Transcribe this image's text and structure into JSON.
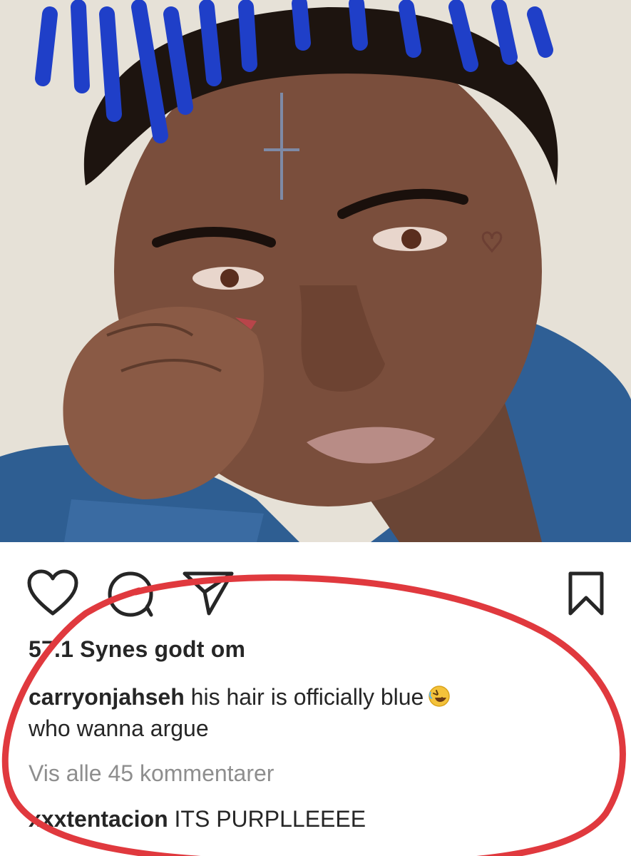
{
  "post": {
    "image_alt": "portrait photo of a man with blue dreadlocks, resting his face on his hand",
    "accent_hair_color": "#1f3fc8",
    "jacket_color": "#2f5f95"
  },
  "actions": {
    "like_icon": "heart-icon",
    "comment_icon": "comment-bubble-icon",
    "share_icon": "paper-plane-icon",
    "save_icon": "bookmark-icon"
  },
  "likes": {
    "text": "57.1 Synes godt om"
  },
  "caption": {
    "username": "carryonjahseh",
    "text_line1": " his hair is officially blue",
    "emoji": "rolling-on-floor-laughing-emoji",
    "text_line2": "who wanna argue"
  },
  "comments": {
    "view_all_label": "Vis alle 45 kommentarer"
  },
  "reply": {
    "username": "xxxtentacion",
    "text": " ITS PURPLLEEEE"
  },
  "annotation": {
    "ellipse_color": "#e0393e"
  }
}
